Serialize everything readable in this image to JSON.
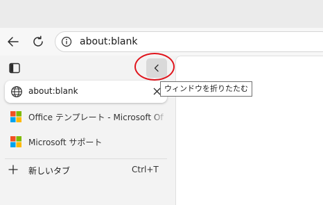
{
  "address_bar": {
    "url": "about:blank"
  },
  "sidebar": {
    "collapse_tooltip": "ウィンドウを折りたたむ",
    "active_tab": {
      "title": "about:blank"
    },
    "tabs": [
      {
        "title": "Office テンプレート - Microsoft Office の"
      },
      {
        "title": "Microsoft サポート"
      }
    ],
    "new_tab": {
      "label": "新しいタブ",
      "shortcut": "Ctrl+T"
    }
  },
  "colors": {
    "highlight": "#e0141c",
    "ms_logo": [
      "#f25022",
      "#7fba00",
      "#00a4ef",
      "#ffb900"
    ]
  },
  "icons": [
    "back-arrow-icon",
    "refresh-icon",
    "info-icon",
    "vertical-tabs-icon",
    "chevron-left-icon",
    "globe-icon",
    "close-icon",
    "microsoft-logo-icon",
    "plus-icon"
  ]
}
